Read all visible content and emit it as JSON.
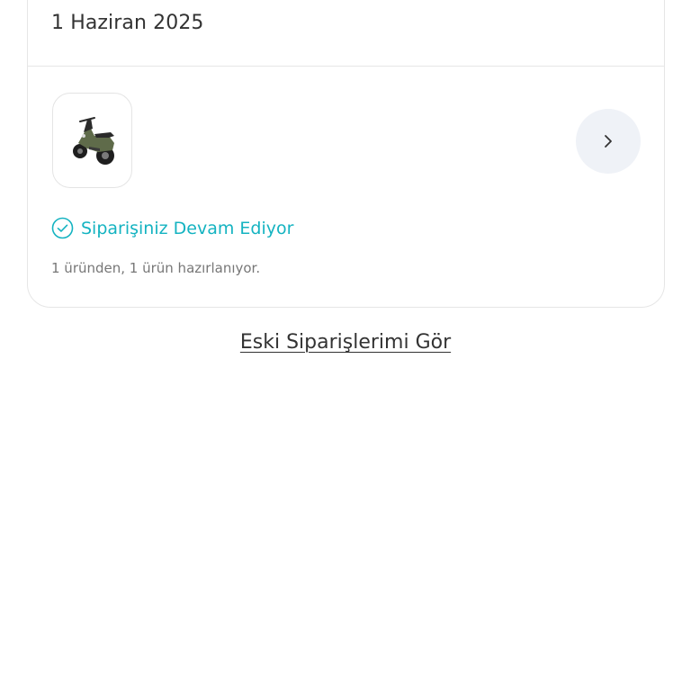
{
  "order": {
    "date": "1 Haziran 2025",
    "product_image": "electric-scooter",
    "status_label": "Siparişiniz Devam Ediyor",
    "status_icon": "check-circle-icon",
    "status_color": "#14b3c1",
    "status_detail": "1 üründen, 1 ürün hazırlanıyor.",
    "detail_icon": "chevron-right-icon"
  },
  "links": {
    "old_orders": "Eski Siparişlerimi Gör"
  }
}
